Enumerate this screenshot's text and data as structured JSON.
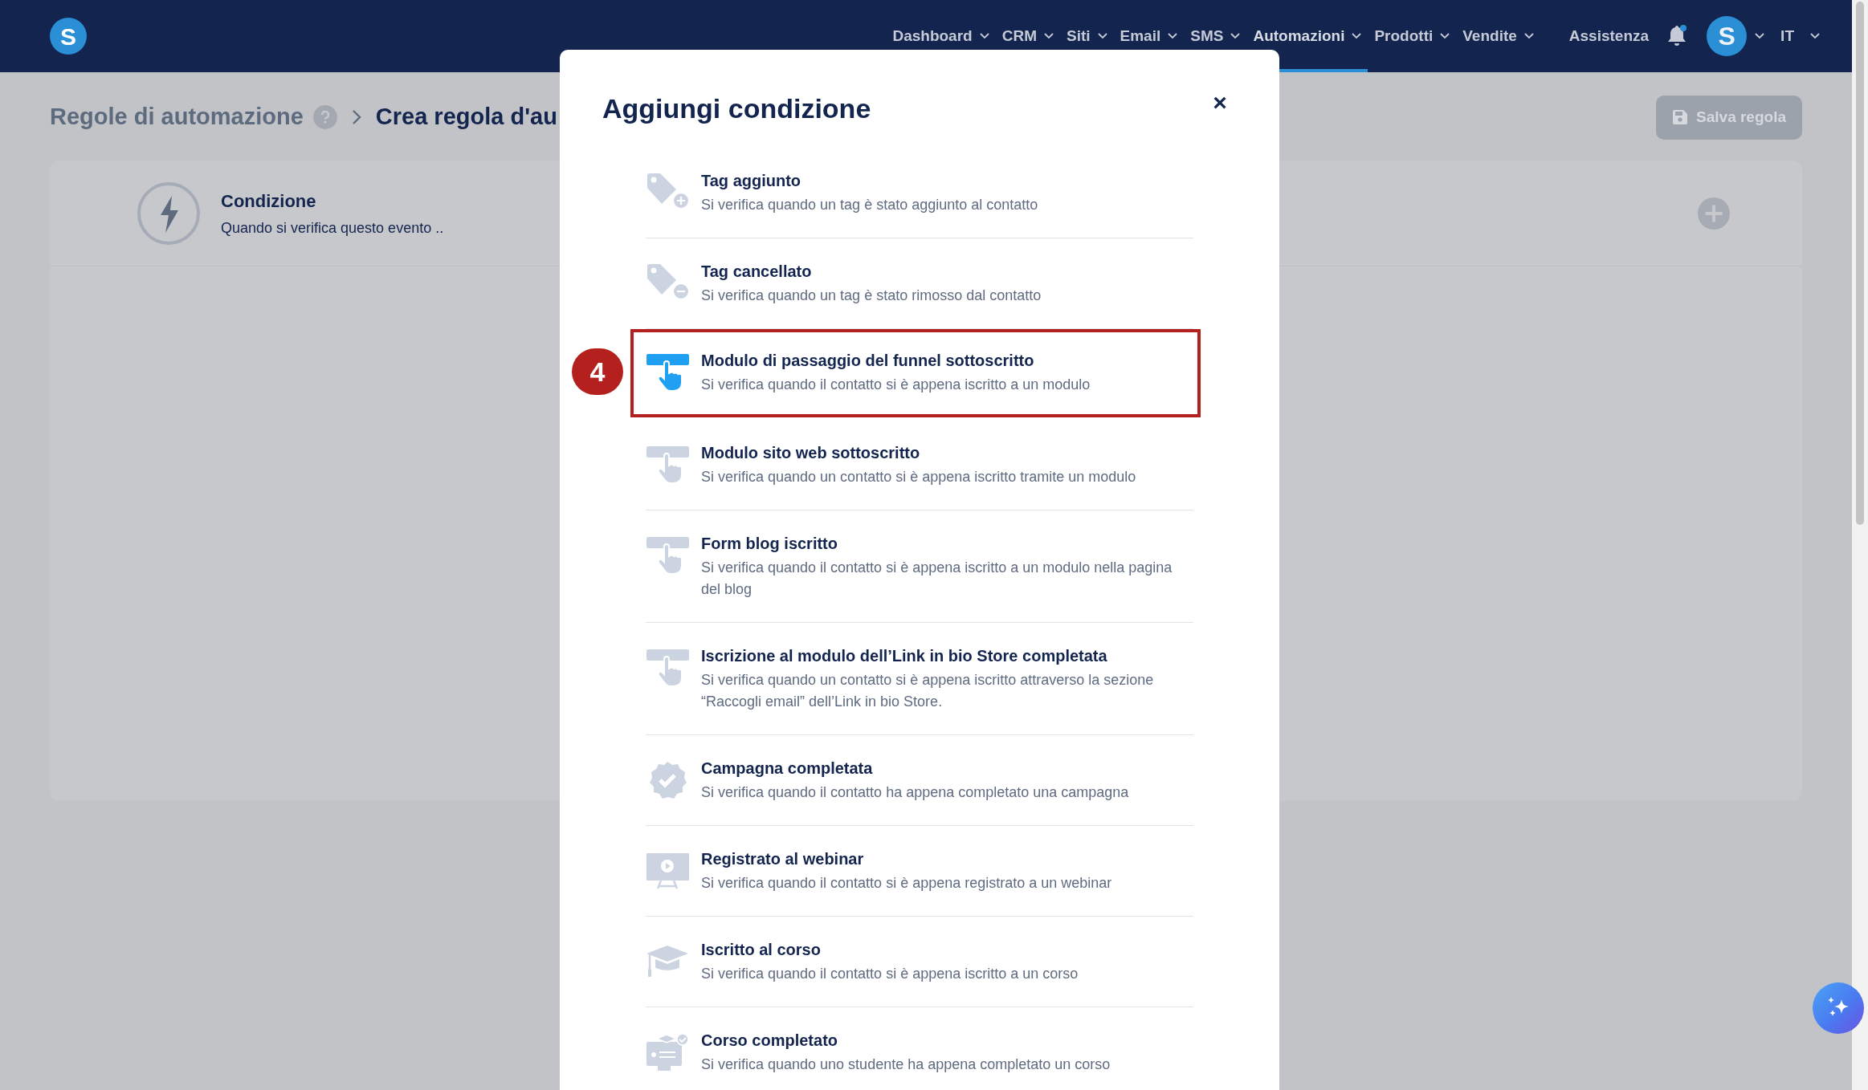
{
  "nav": {
    "items": [
      {
        "label": "Dashboard",
        "caret": true,
        "selected": false
      },
      {
        "label": "CRM",
        "caret": true,
        "selected": false
      },
      {
        "label": "Siti",
        "caret": true,
        "selected": false
      },
      {
        "label": "Email",
        "caret": true,
        "selected": false
      },
      {
        "label": "SMS",
        "caret": true,
        "selected": false
      },
      {
        "label": "Automazioni",
        "caret": true,
        "selected": true
      },
      {
        "label": "Prodotti",
        "caret": true,
        "selected": false
      },
      {
        "label": "Vendite",
        "caret": true,
        "selected": false
      }
    ],
    "help": "Assistenza",
    "avatar": "S",
    "language": "IT",
    "logo": "S"
  },
  "breadcrumb": {
    "parent": "Regole di automazione",
    "current": "Crea regola d'au"
  },
  "save_button": "Salva regola",
  "condition_card": {
    "title": "Condizione",
    "subtitle": "Quando si verifica questo evento .."
  },
  "modal": {
    "title": "Aggiungi condizione",
    "close": "×",
    "items": [
      {
        "kind": "tag-add",
        "title": "Tag aggiunto",
        "description": "Si verifica quando un tag è stato aggiunto al contatto",
        "selected": false
      },
      {
        "kind": "tag-remove",
        "title": "Tag cancellato",
        "description": "Si verifica quando un tag è stato rimosso dal contatto",
        "selected": false
      },
      {
        "kind": "form",
        "title": "Modulo di passaggio del funnel sottoscritto",
        "description": "Si verifica quando il contatto si è appena iscritto a un modulo",
        "selected": true,
        "callout": "4"
      },
      {
        "kind": "form",
        "title": "Modulo sito web sottoscritto",
        "description": "Si verifica quando un contatto si è appena iscritto tramite un modulo",
        "selected": false
      },
      {
        "kind": "form",
        "title": "Form blog iscritto",
        "description": "Si verifica quando il contatto si è appena iscritto a un modulo nella pagina del blog",
        "selected": false
      },
      {
        "kind": "form",
        "title": "Iscrizione al modulo dell’Link in bio Store completata",
        "description": "Si verifica quando un contatto si è appena iscritto attraverso la sezione “Raccogli email” dell’Link in bio Store.",
        "selected": false
      },
      {
        "kind": "campaign",
        "title": "Campagna completata",
        "description": "Si verifica quando il contatto ha appena completato una campagna",
        "selected": false
      },
      {
        "kind": "webinar",
        "title": "Registrato al webinar",
        "description": "Si verifica quando il contatto si è appena registrato a un webinar",
        "selected": false
      },
      {
        "kind": "course",
        "title": "Iscritto al corso",
        "description": "Si verifica quando il contatto si è appena iscritto a un corso",
        "selected": false
      },
      {
        "kind": "course-done",
        "title": "Corso completato",
        "description": "Si verifica quando uno studente ha appena completato un corso",
        "selected": false
      }
    ]
  }
}
